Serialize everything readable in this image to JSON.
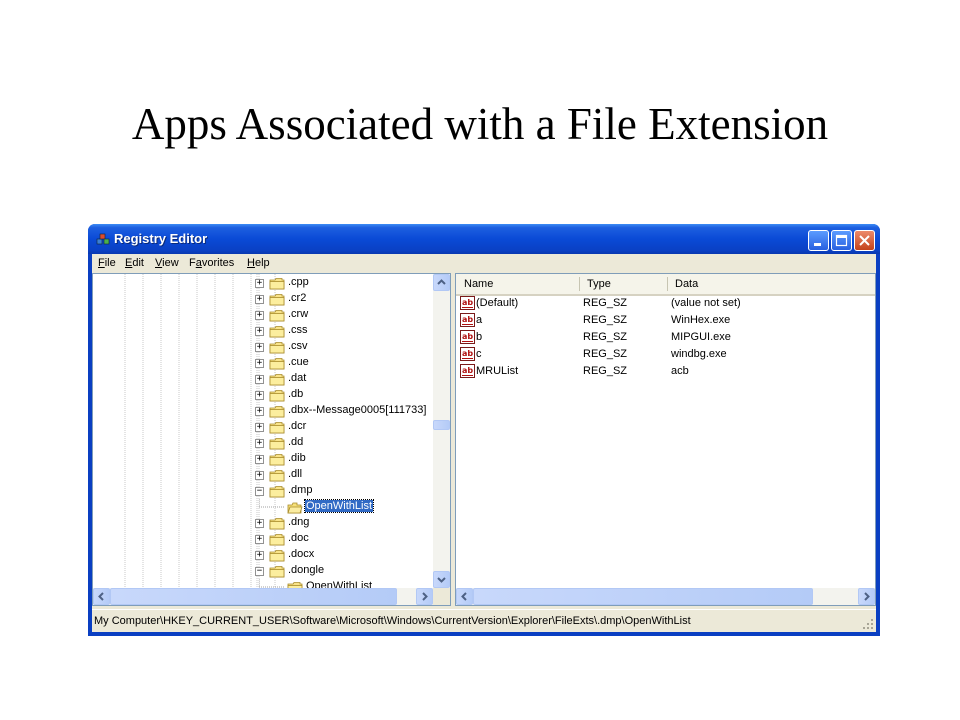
{
  "slide": {
    "title": "Apps Associated with a File Extension"
  },
  "window": {
    "title": "Registry Editor"
  },
  "menu": [
    {
      "pre": "",
      "key": "F",
      "post": "ile"
    },
    {
      "pre": "",
      "key": "E",
      "post": "dit"
    },
    {
      "pre": "",
      "key": "V",
      "post": "iew"
    },
    {
      "pre": "F",
      "key": "a",
      "post": "vorites"
    },
    {
      "pre": "",
      "key": "H",
      "post": "elp"
    }
  ],
  "tree": [
    {
      "label": ".cpp",
      "state": "collapsed",
      "level": 0
    },
    {
      "label": ".cr2",
      "state": "collapsed",
      "level": 0
    },
    {
      "label": ".crw",
      "state": "collapsed",
      "level": 0
    },
    {
      "label": ".css",
      "state": "collapsed",
      "level": 0
    },
    {
      "label": ".csv",
      "state": "collapsed",
      "level": 0
    },
    {
      "label": ".cue",
      "state": "collapsed",
      "level": 0
    },
    {
      "label": ".dat",
      "state": "collapsed",
      "level": 0
    },
    {
      "label": ".db",
      "state": "collapsed",
      "level": 0
    },
    {
      "label": ".dbx--Message0005[111733]",
      "state": "collapsed",
      "level": 0
    },
    {
      "label": ".dcr",
      "state": "collapsed",
      "level": 0
    },
    {
      "label": ".dd",
      "state": "collapsed",
      "level": 0
    },
    {
      "label": ".dib",
      "state": "collapsed",
      "level": 0
    },
    {
      "label": ".dll",
      "state": "collapsed",
      "level": 0
    },
    {
      "label": ".dmp",
      "state": "expanded",
      "level": 0
    },
    {
      "label": "OpenWithList",
      "state": "leaf",
      "level": 1,
      "selected": true
    },
    {
      "label": ".dng",
      "state": "collapsed",
      "level": 0
    },
    {
      "label": ".doc",
      "state": "collapsed",
      "level": 0
    },
    {
      "label": ".docx",
      "state": "collapsed",
      "level": 0
    },
    {
      "label": ".dongle",
      "state": "expanded",
      "level": 0
    },
    {
      "label": "OpenWithList",
      "state": "leaf",
      "level": 1
    }
  ],
  "columns": {
    "name": "Name",
    "type": "Type",
    "data": "Data"
  },
  "values": [
    {
      "name": "(Default)",
      "type": "REG_SZ",
      "data": "(value not set)",
      "icon": "string-value-icon"
    },
    {
      "name": "a",
      "type": "REG_SZ",
      "data": "WinHex.exe",
      "icon": "string-value-icon"
    },
    {
      "name": "b",
      "type": "REG_SZ",
      "data": "MIPGUI.exe",
      "icon": "string-value-icon"
    },
    {
      "name": "c",
      "type": "REG_SZ",
      "data": "windbg.exe",
      "icon": "string-value-icon"
    },
    {
      "name": "MRUList",
      "type": "REG_SZ",
      "data": "acb",
      "icon": "string-value-icon"
    }
  ],
  "status": {
    "path": "My Computer\\HKEY_CURRENT_USER\\Software\\Microsoft\\Windows\\CurrentVersion\\Explorer\\FileExts\\.dmp\\OpenWithList"
  },
  "colors": {
    "titlebar": "#0a4ad6",
    "selection": "#316ac5",
    "frame": "#ece9d8"
  }
}
